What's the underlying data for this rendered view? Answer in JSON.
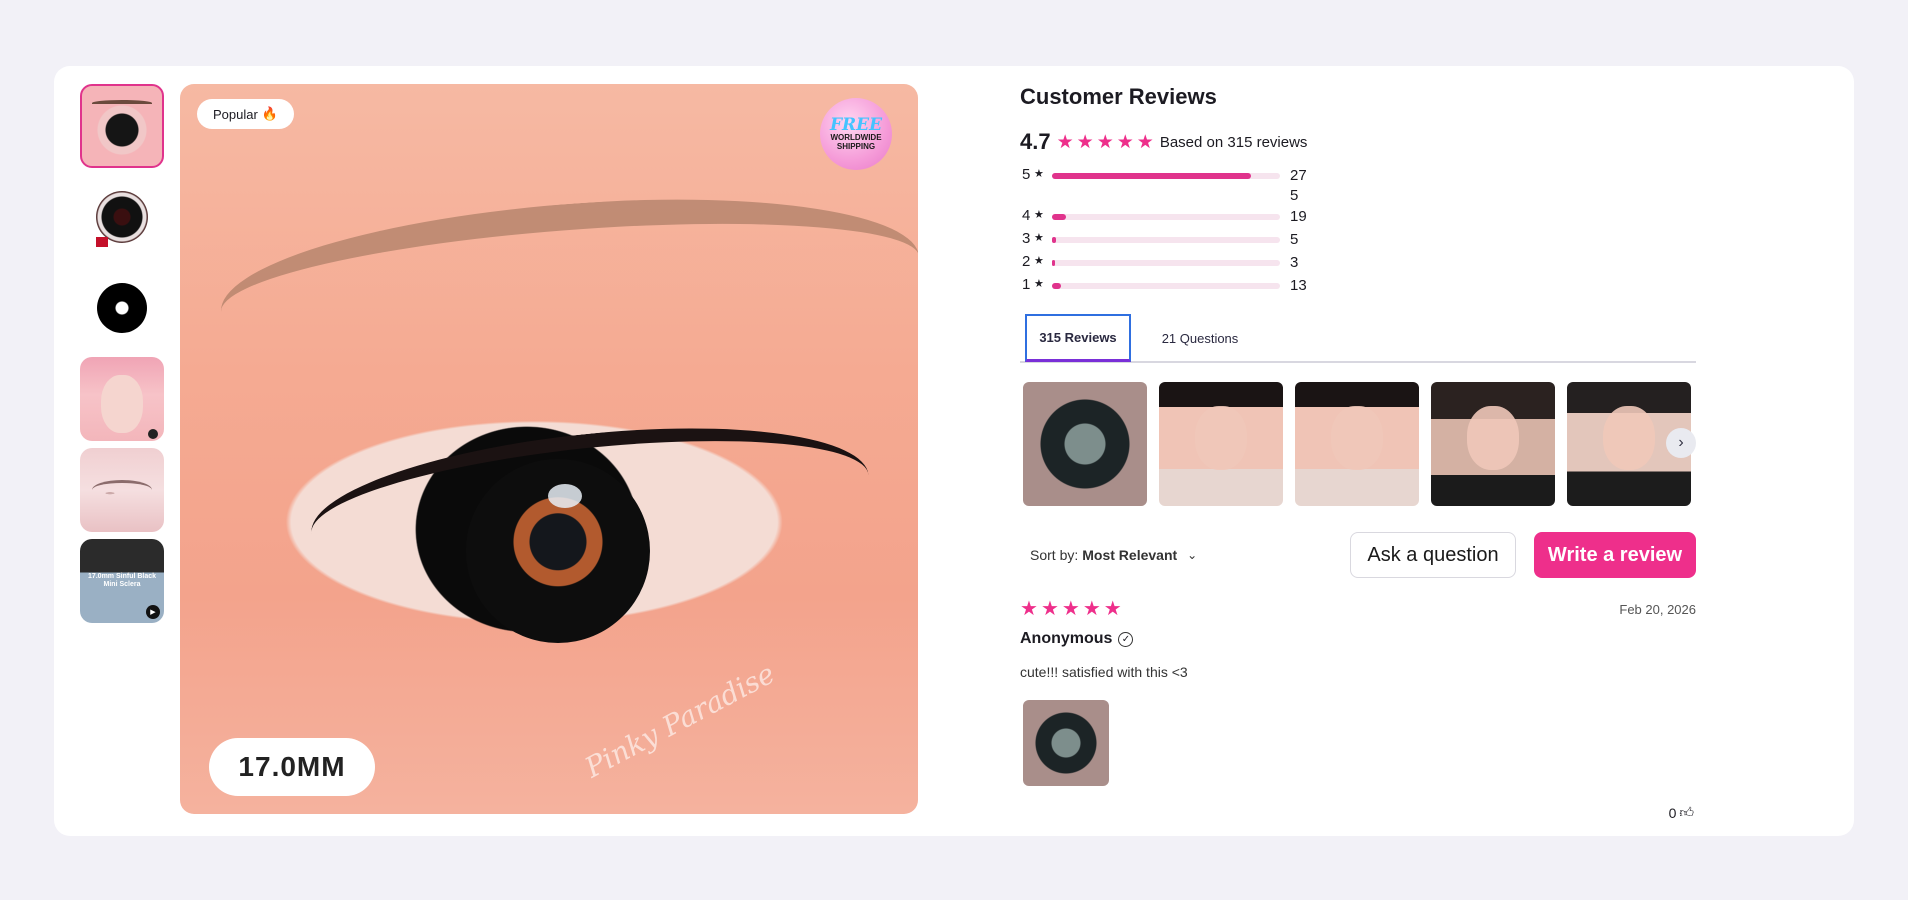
{
  "gallery": {
    "badge_popular": "Popular",
    "badge_popular_emoji": "🔥",
    "shipping_badge": {
      "line1": "FREE",
      "line2": "WORLDWIDE",
      "line3": "SHIPPING"
    },
    "size_label": "17.0MM",
    "watermark": "Pinky Paradise",
    "thumb6_caption": "17.0mm Sinful Black Mini Sclera",
    "active_thumb_color": "#e0338c"
  },
  "reviews": {
    "title": "Customer Reviews",
    "average": "4.7",
    "based_on": "Based on 315 reviews",
    "star_color": "#ee2f8b",
    "distribution": [
      {
        "stars": "5",
        "count": "275",
        "fraction": 0.873
      },
      {
        "stars": "4",
        "count": "19",
        "fraction": 0.06
      },
      {
        "stars": "3",
        "count": "5",
        "fraction": 0.016
      },
      {
        "stars": "2",
        "count": "3",
        "fraction": 0.01
      },
      {
        "stars": "1",
        "count": "13",
        "fraction": 0.041
      }
    ],
    "tabs": [
      {
        "label": "315 Reviews"
      },
      {
        "label": "21 Questions"
      }
    ],
    "sort_label": "Sort by:",
    "sort_value": "Most Relevant",
    "ask_button": "Ask a question",
    "write_button": "Write a review",
    "items": [
      {
        "rating": 5,
        "date": "Feb 20, 2026",
        "author": "Anonymous",
        "body": "cute!!! satisfied with this <3",
        "likes": "0"
      }
    ]
  }
}
